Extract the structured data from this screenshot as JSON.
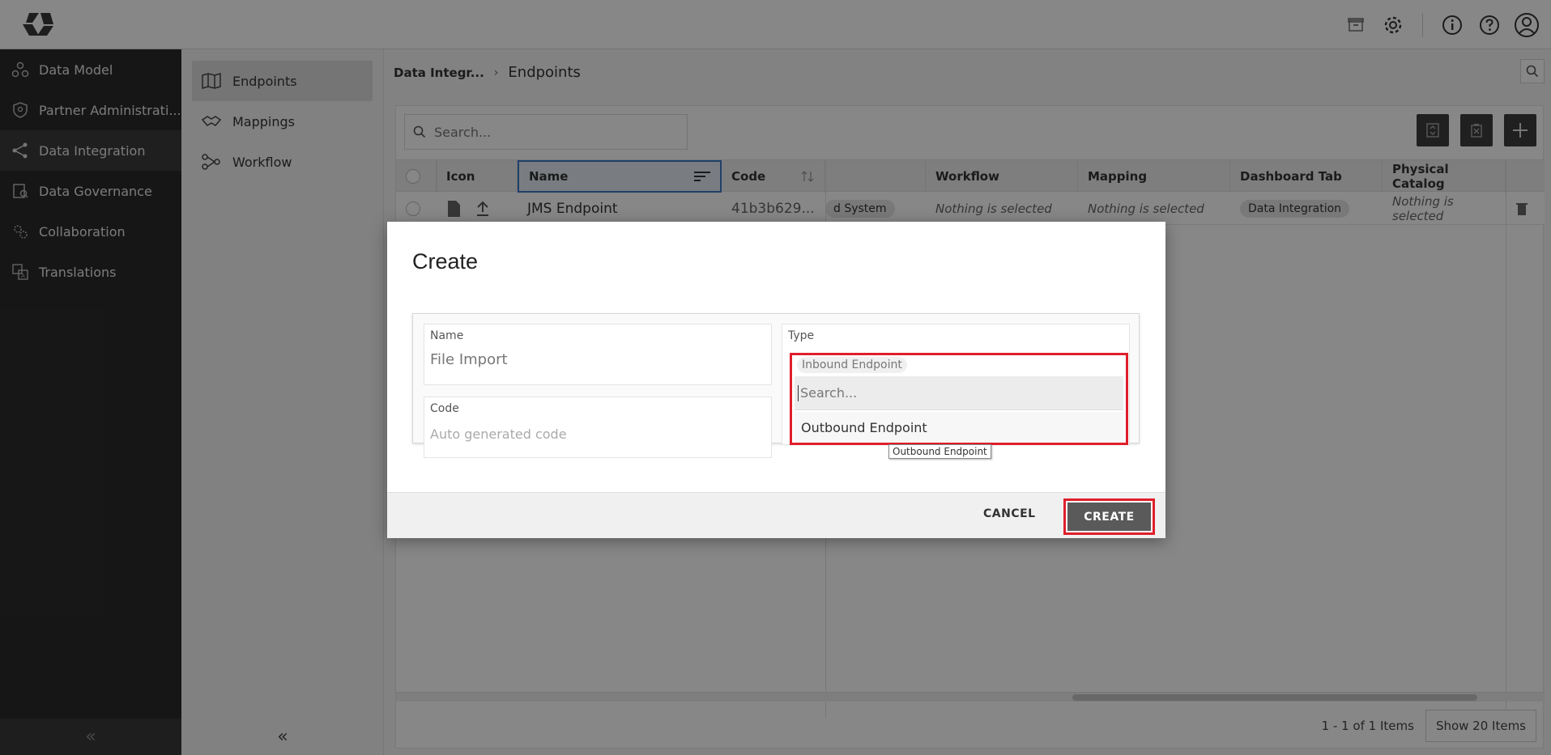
{
  "nav": {
    "items": [
      {
        "label": "Data Model",
        "icon": "data-model-icon"
      },
      {
        "label": "Partner Administrati...",
        "icon": "shield-icon"
      },
      {
        "label": "Data Integration",
        "icon": "share-icon",
        "active": true
      },
      {
        "label": "Data Governance",
        "icon": "governance-icon"
      },
      {
        "label": "Collaboration",
        "icon": "collaboration-icon"
      },
      {
        "label": "Translations",
        "icon": "translate-icon"
      }
    ],
    "collapse": "«"
  },
  "subnav": {
    "items": [
      {
        "label": "Endpoints",
        "icon": "map-icon",
        "active": true
      },
      {
        "label": "Mappings",
        "icon": "handshake-icon"
      },
      {
        "label": "Workflow",
        "icon": "workflow-icon"
      }
    ],
    "collapse": "«"
  },
  "breadcrumb": {
    "parent": "Data Integr...",
    "separator": "›",
    "current": "Endpoints"
  },
  "grid": {
    "search_placeholder": "Search...",
    "columns": [
      "Icon",
      "Name",
      "Code",
      "Workflow",
      "Mapping",
      "Dashboard Tab",
      "Physical Catalog"
    ],
    "row": {
      "name": "JMS Endpoint",
      "code": "41b3b629...",
      "type_chip": "d System",
      "workflow": "Nothing is selected",
      "mapping": "Nothing is selected",
      "dashboard_tab": "Data Integration",
      "physical_catalog": "Nothing is selected"
    },
    "pager_text": "1 - 1 of 1 Items",
    "pager_button": "Show 20 Items"
  },
  "modal": {
    "title": "Create",
    "name_label": "Name",
    "name_value": "File Import",
    "type_label": "Type",
    "code_label": "Code",
    "code_placeholder": "Auto generated code",
    "dropdown": {
      "selected": "Inbound Endpoint",
      "search_placeholder": "Search...",
      "options": [
        "Outbound Endpoint"
      ]
    },
    "tooltip": "Outbound Endpoint",
    "cancel_label": "CANCEL",
    "create_label": "CREATE"
  }
}
